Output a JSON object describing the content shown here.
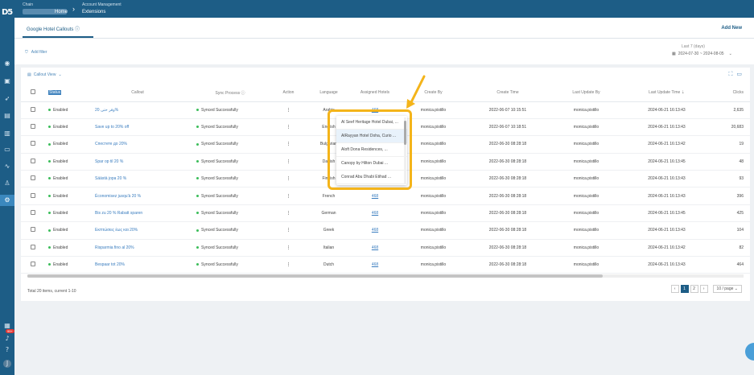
{
  "brand": {
    "logo_text": "D5"
  },
  "nav": {
    "icons": [
      "eye-icon",
      "box-icon",
      "rocket-icon",
      "panel-icon",
      "document-icon",
      "folder-icon",
      "activity-icon",
      "user-icon",
      "settings-icon"
    ],
    "bottom_icons": [
      "grid-icon",
      "bell-icon",
      "help-icon",
      "user-avatar-icon"
    ],
    "badge": "99+"
  },
  "topbar": {
    "org_label": "Chain",
    "org_suffix": "Home",
    "crumb_top": "Account Management",
    "crumb_main": "Extensions"
  },
  "tabs": {
    "active": "Google Hotel Callouts ⓘ",
    "add_new": "Add New"
  },
  "filter": {
    "add_filter": "Add filter"
  },
  "date": {
    "label": "Last 7 (days)",
    "range": "2024-07-30 ~ 2024-08-05"
  },
  "view": {
    "callout_view": "Callout View"
  },
  "table": {
    "headers": [
      "",
      "Status",
      "Callout",
      "Sync Process ⓘ",
      "Action",
      "Language",
      "Assigned Hotels",
      "Create By",
      "Create Time",
      "Last Update By",
      "Last Update Time ⇣",
      "Clicks"
    ],
    "rows": [
      {
        "status": "Enabled",
        "callout": "وفر حتى 20%",
        "sync": "Synced Successfully",
        "language": "Arabic",
        "hotels": "468",
        "create_by": "monica.pistillo",
        "create_time": "2022-06-07 10:15:51",
        "update_by": "monica.pistillo",
        "update_time": "2024-06-21 16:13:43",
        "clicks": "2,635"
      },
      {
        "status": "Enabled",
        "callout": "Save up to 20% off",
        "sync": "Synced Successfully",
        "language": "English",
        "hotels": "468",
        "create_by": "monica.pistillo",
        "create_time": "2022-06-07 10:18:51",
        "update_by": "monica.pistillo",
        "update_time": "2024-06-21 16:13:43",
        "clicks": "20,683"
      },
      {
        "status": "Enabled",
        "callout": "Спестете до 20%",
        "sync": "Synced Successfully",
        "language": "Bulgarian",
        "hotels": "468",
        "create_by": "monica.pistillo",
        "create_time": "2022-06-30 08:28:18",
        "update_by": "monica.pistillo",
        "update_time": "2024-06-21 16:13:42",
        "clicks": "19"
      },
      {
        "status": "Enabled",
        "callout": "Spar op til 20 %",
        "sync": "Synced Successfully",
        "language": "Danish",
        "hotels": "468",
        "create_by": "monica.pistillo",
        "create_time": "2022-06-30 08:28:18",
        "update_by": "monica.pistillo",
        "update_time": "2024-06-21 16:13:45",
        "clicks": "48"
      },
      {
        "status": "Enabled",
        "callout": "Säästä jopa 20 %",
        "sync": "Synced Successfully",
        "language": "Finnish",
        "hotels": "468",
        "create_by": "monica.pistillo",
        "create_time": "2022-06-30 08:28:18",
        "update_by": "monica.pistillo",
        "update_time": "2024-06-21 16:13:43",
        "clicks": "93"
      },
      {
        "status": "Enabled",
        "callout": "Économisez jusqu'à 20 %",
        "sync": "Synced Successfully",
        "language": "French",
        "hotels": "468",
        "create_by": "monica.pistillo",
        "create_time": "2022-06-30 08:28:18",
        "update_by": "monica.pistillo",
        "update_time": "2024-06-21 16:13:43",
        "clicks": "396"
      },
      {
        "status": "Enabled",
        "callout": "Bis zu 20 % Rabatt sparen",
        "sync": "Synced Successfully",
        "language": "German",
        "hotels": "468",
        "create_by": "monica.pistillo",
        "create_time": "2022-06-30 08:28:18",
        "update_by": "monica.pistillo",
        "update_time": "2024-06-21 16:13:45",
        "clicks": "425"
      },
      {
        "status": "Enabled",
        "callout": "Εκπτώσεις έως και 20%",
        "sync": "Synced Successfully",
        "language": "Greek",
        "hotels": "468",
        "create_by": "monica.pistillo",
        "create_time": "2022-06-30 08:28:18",
        "update_by": "monica.pistillo",
        "update_time": "2024-06-21 16:13:43",
        "clicks": "104"
      },
      {
        "status": "Enabled",
        "callout": "Risparmia fino al 20%",
        "sync": "Synced Successfully",
        "language": "Italian",
        "hotels": "468",
        "create_by": "monica.pistillo",
        "create_time": "2022-06-30 08:28:18",
        "update_by": "monica.pistillo",
        "update_time": "2024-06-21 16:13:42",
        "clicks": "82"
      },
      {
        "status": "Enabled",
        "callout": "Bespaar tot 20%",
        "sync": "Synced Successfully",
        "language": "Dutch",
        "hotels": "468",
        "create_by": "monica.pistillo",
        "create_time": "2022-06-30 08:28:18",
        "update_by": "monica.pistillo",
        "update_time": "2024-06-21 16:13:43",
        "clicks": "464"
      }
    ]
  },
  "dropdown": {
    "items": [
      "Al Seef Heritage Hotel Dubai, ...",
      "AlRayyan Hotel Doha, Curio ...",
      "Aloft Dona Residences, ...",
      "Canopy by Hilton Dubai ...",
      "Conrad Abu Dhabi Etihad ..."
    ]
  },
  "footer": {
    "total": "Total 20 items, current 1-10",
    "pages": [
      "1",
      "2"
    ],
    "page_size": "10 / page"
  },
  "colors": {
    "brand": "#1d5d86",
    "accent": "#3a7dbf",
    "success": "#3bbd5a",
    "callout_highlight": "#f4b41a"
  }
}
